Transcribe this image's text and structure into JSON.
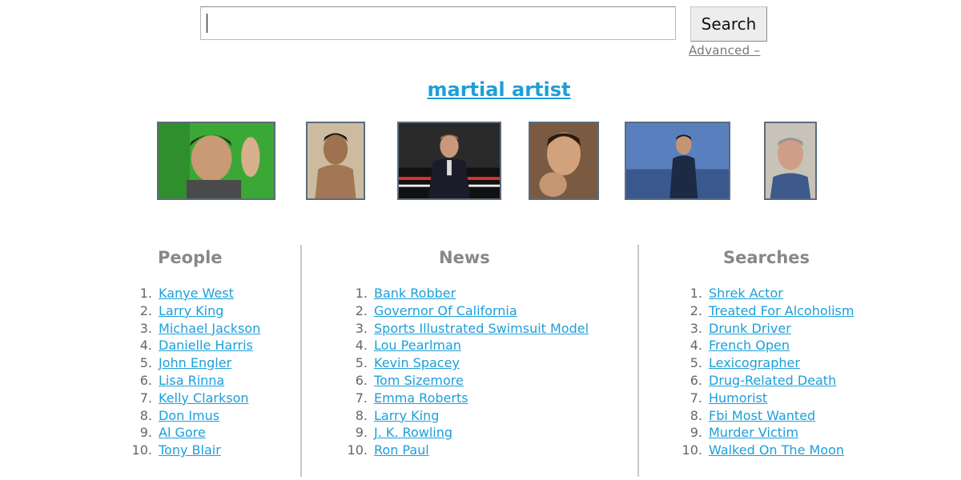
{
  "search": {
    "input_value": "",
    "button_label": "Search",
    "advanced_label": "Advanced –"
  },
  "topic": {
    "title": "martial artist"
  },
  "columns": {
    "people": {
      "heading": "People",
      "items": [
        {
          "num": "1.",
          "label": "Kanye West"
        },
        {
          "num": "2.",
          "label": "Larry King"
        },
        {
          "num": "3.",
          "label": "Michael Jackson"
        },
        {
          "num": "4.",
          "label": "Danielle Harris"
        },
        {
          "num": "5.",
          "label": "John Engler"
        },
        {
          "num": "6.",
          "label": "Lisa Rinna"
        },
        {
          "num": "7.",
          "label": "Kelly Clarkson"
        },
        {
          "num": "8.",
          "label": "Don Imus"
        },
        {
          "num": "9.",
          "label": "Al Gore"
        },
        {
          "num": "10.",
          "label": "Tony Blair"
        }
      ]
    },
    "news": {
      "heading": "News",
      "items": [
        {
          "num": "1.",
          "label": "Bank Robber"
        },
        {
          "num": "2.",
          "label": "Governor Of California"
        },
        {
          "num": "3.",
          "label": "Sports Illustrated Swimsuit Model"
        },
        {
          "num": "4.",
          "label": "Lou Pearlman"
        },
        {
          "num": "5.",
          "label": "Kevin Spacey"
        },
        {
          "num": "6.",
          "label": "Tom Sizemore"
        },
        {
          "num": "7.",
          "label": "Emma Roberts"
        },
        {
          "num": "8.",
          "label": "Larry King"
        },
        {
          "num": "9.",
          "label": "J. K. Rowling"
        },
        {
          "num": "10.",
          "label": "Ron Paul"
        }
      ]
    },
    "searches": {
      "heading": "Searches",
      "items": [
        {
          "num": "1.",
          "label": "Shrek Actor"
        },
        {
          "num": "2.",
          "label": "Treated For Alcoholism"
        },
        {
          "num": "3.",
          "label": "Drunk Driver"
        },
        {
          "num": "4.",
          "label": "French Open"
        },
        {
          "num": "5.",
          "label": "Lexicographer"
        },
        {
          "num": "6.",
          "label": "Drug-Related Death"
        },
        {
          "num": "7.",
          "label": "Humorist"
        },
        {
          "num": "8.",
          "label": "Fbi Most Wanted"
        },
        {
          "num": "9.",
          "label": "Murder Victim"
        },
        {
          "num": "10.",
          "label": "Walked On The Moon"
        }
      ]
    }
  },
  "colors": {
    "link": "#1c9fd9",
    "heading": "#888888",
    "divider": "#c9c9c9",
    "thumb_border": "#5b6b7c"
  }
}
